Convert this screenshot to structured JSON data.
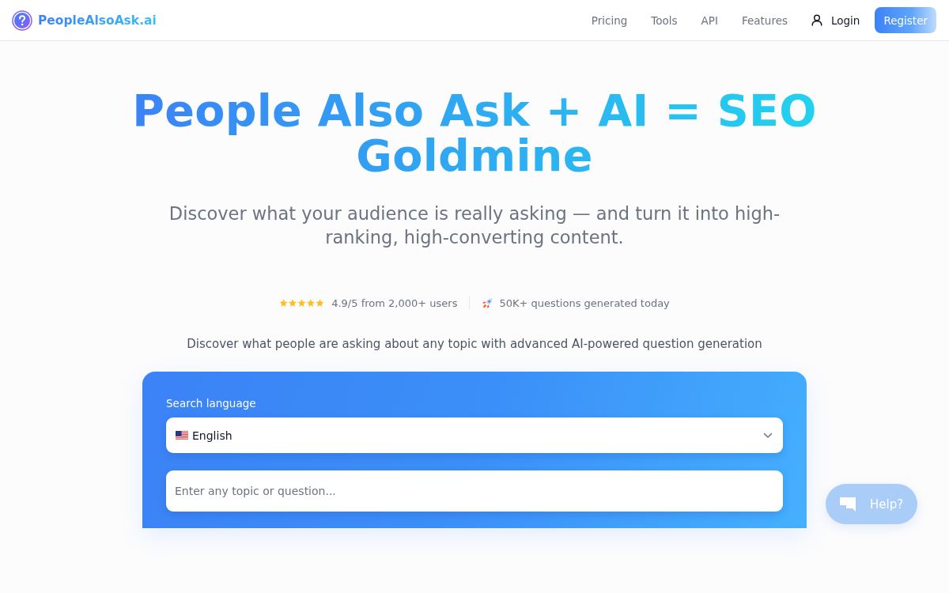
{
  "header": {
    "logo": "PeopleAlsoAsk.ai",
    "nav": [
      "Pricing",
      "Tools",
      "API",
      "Features"
    ],
    "login": "Login",
    "register": "Register"
  },
  "hero": {
    "title": "People Also Ask + AI = SEO Goldmine",
    "subtitle": "Discover what your audience is really asking — and turn it into high-ranking, high-converting content."
  },
  "stats": [
    {
      "kind": "rating",
      "stars": 5,
      "text": "4.9/5 from 2,000+ users"
    },
    {
      "kind": "rocket",
      "text": "50K+ questions generated today"
    }
  ],
  "tagline": "Discover what people are asking about any topic with advanced AI-powered question generation",
  "search_card": {
    "language_label": "Search language",
    "language": {
      "value": "English"
    },
    "topic": {
      "placeholder": "Enter any topic or question..."
    }
  },
  "help_button": {
    "label": "Help?"
  }
}
